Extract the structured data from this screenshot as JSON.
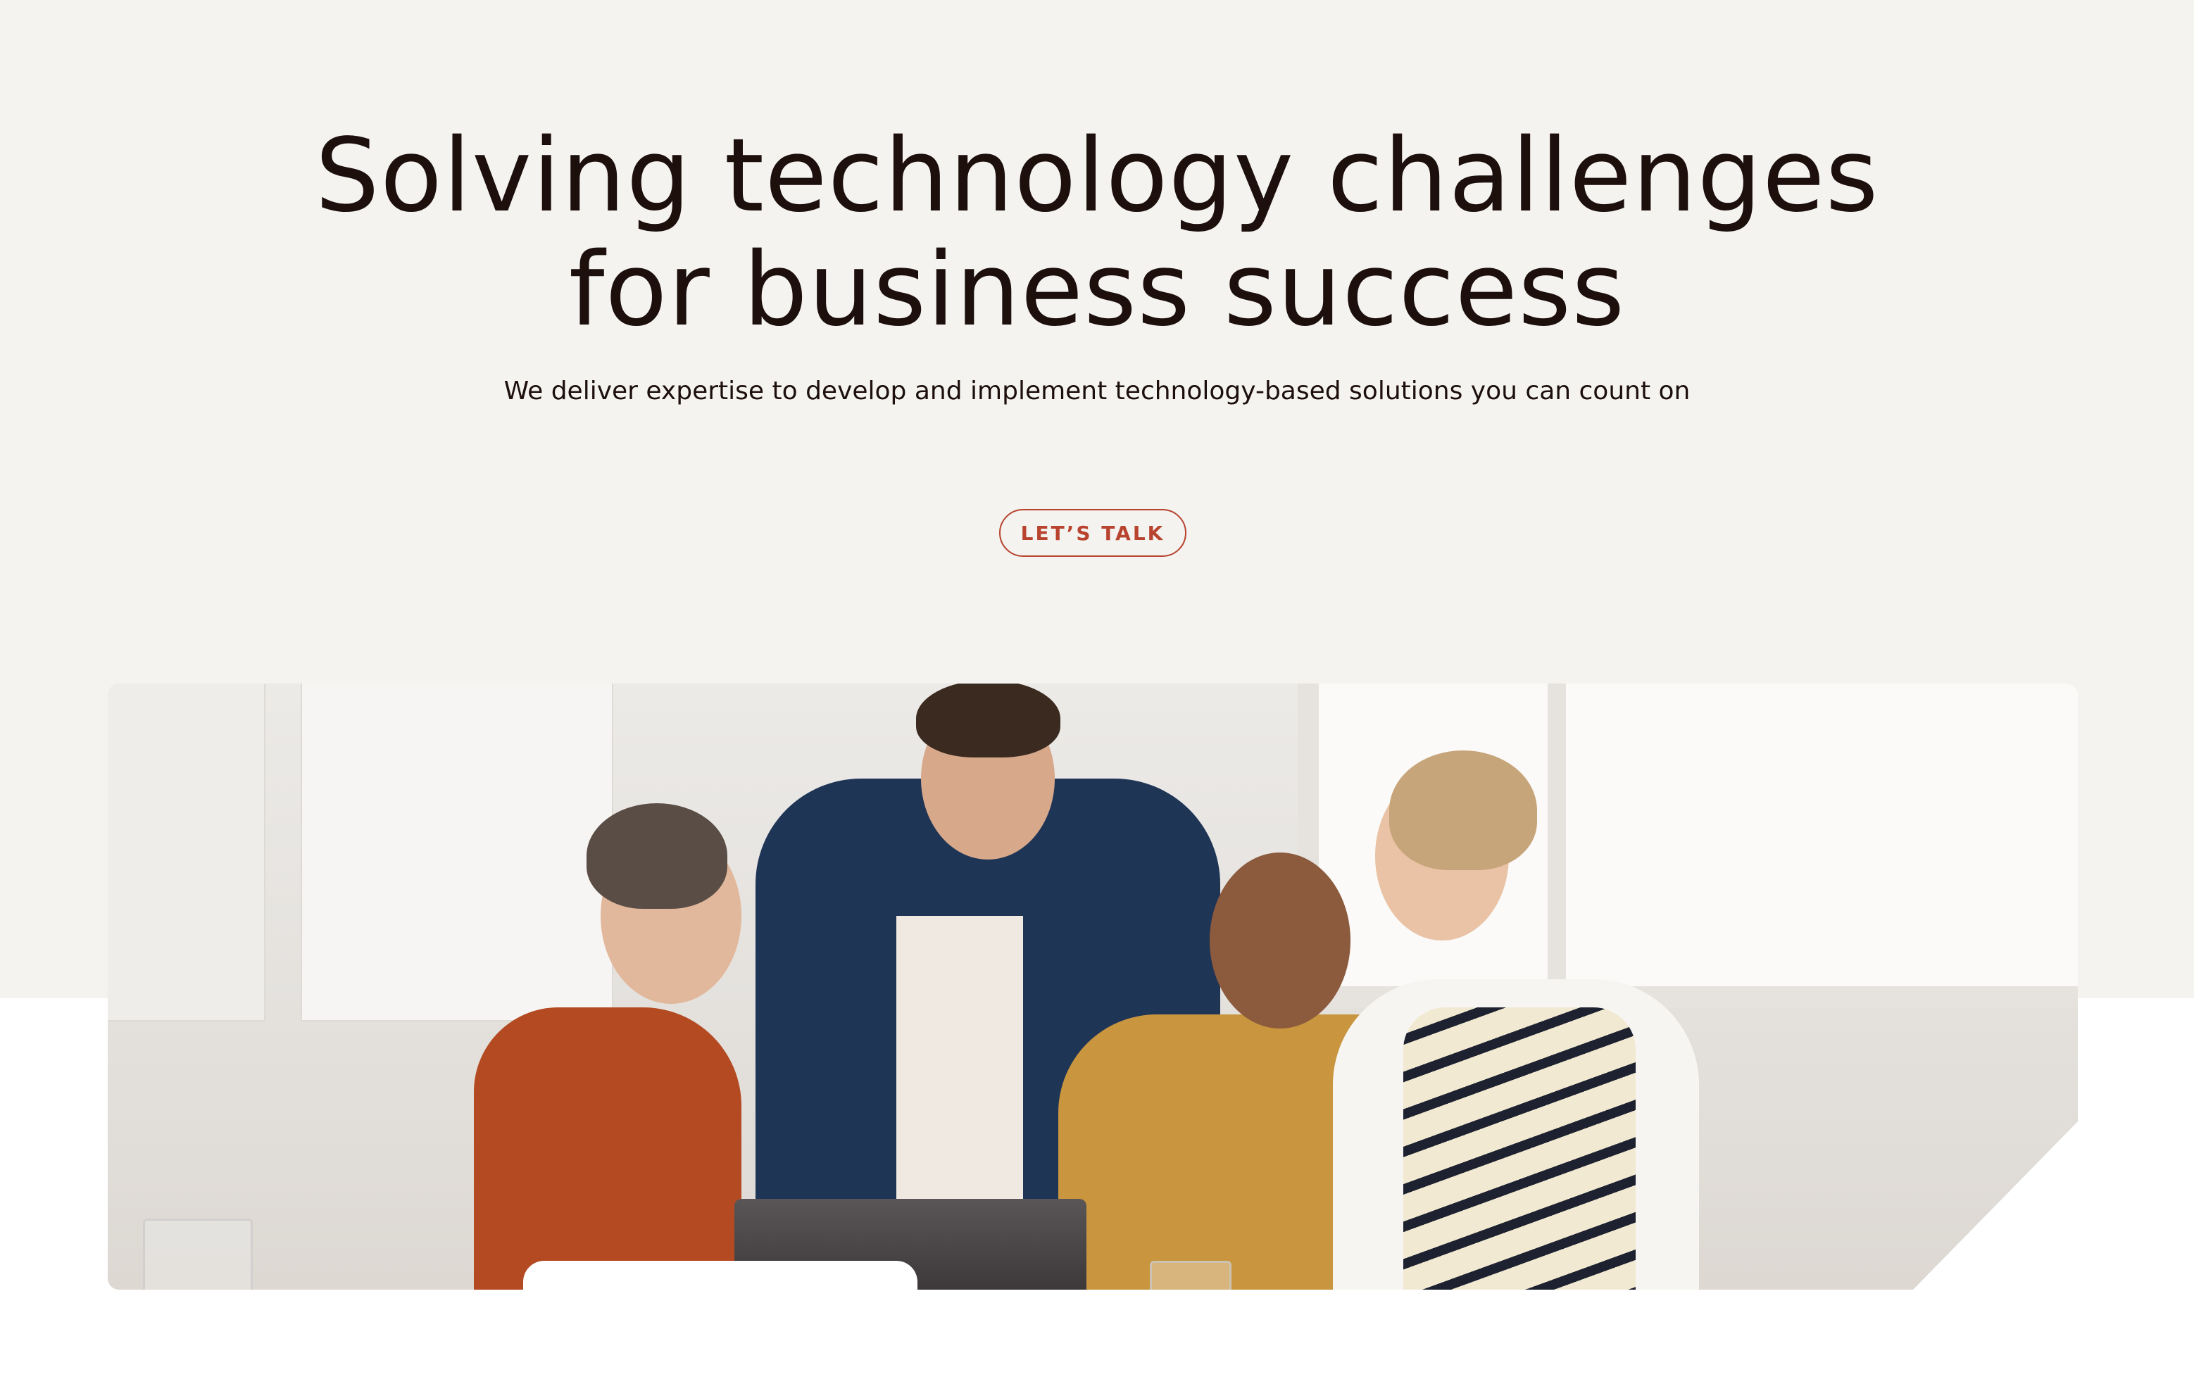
{
  "hero": {
    "headline_line1": "Solving technology challenges",
    "headline_line2": "for business success",
    "subheadline": "We deliver expertise to develop and implement technology-based solutions you can count on",
    "cta_label": "LET’S TALK"
  },
  "photo": {
    "subject": "team-meeting-photo"
  },
  "colors": {
    "hero_background": "#f4f3f0",
    "page_background": "#ffffff",
    "text": "#1c0f0c",
    "accent": "#b8432f"
  }
}
